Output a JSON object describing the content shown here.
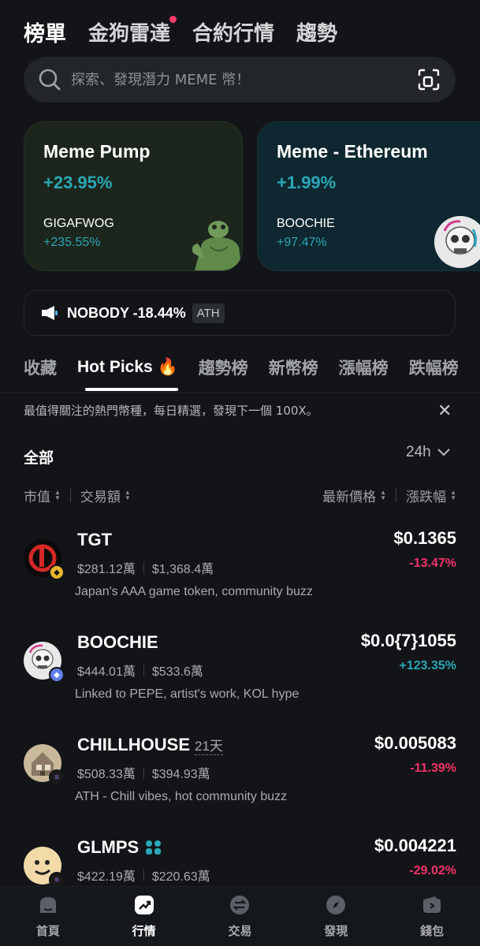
{
  "top_tabs": [
    "榜單",
    "金狗雷達",
    "合約行情",
    "趨勢"
  ],
  "search": {
    "placeholder": "探索、發現潛力 MEME 幣！"
  },
  "cards": [
    {
      "title": "Meme Pump",
      "change": "+23.95%",
      "token": "GIGAFWOG",
      "token_change": "+235.55%"
    },
    {
      "title": "Meme - Ethereum",
      "change": "+1.99%",
      "token": "BOOCHIE",
      "token_change": "+97.47%"
    }
  ],
  "ticker": {
    "text": "NOBODY -18.44%",
    "badge": "ATH"
  },
  "category_tabs": [
    "收藏",
    "Hot Picks 🔥",
    "趨勢榜",
    "新幣榜",
    "漲幅榜",
    "跌幅榜"
  ],
  "description": "最值得關注的熱門幣種，每日精選，發現下一個 100X。",
  "filter": {
    "all": "全部",
    "range": "24h"
  },
  "sort": {
    "market_cap": "市值",
    "volume": "交易額",
    "price": "最新價格",
    "change": "漲跌幅"
  },
  "tokens": [
    {
      "name": "TGT",
      "age": "",
      "market_cap": "$281.12萬",
      "volume": "$1,368.4萬",
      "desc": "Japan's AAA game token, community buzz",
      "price": "$0.1365",
      "change": "-13.47%",
      "direction": "neg"
    },
    {
      "name": "BOOCHIE",
      "age": "",
      "market_cap": "$444.01萬",
      "volume": "$533.6萬",
      "desc": "Linked to PEPE, artist's work, KOL hype",
      "price": "$0.0{7}1055",
      "change": "+123.35%",
      "direction": "pos"
    },
    {
      "name": "CHILLHOUSE",
      "age": "21天",
      "market_cap": "$508.33萬",
      "volume": "$394.93萬",
      "desc": "ATH - Chill vibes, hot community buzz",
      "price": "$0.005083",
      "change": "-11.39%",
      "direction": "neg"
    },
    {
      "name": "GLMPS",
      "age": "",
      "market_cap": "$422.19萬",
      "volume": "$220.63萬",
      "desc": "",
      "price": "$0.004221",
      "change": "-29.02%",
      "direction": "neg"
    }
  ],
  "bottom_nav": [
    "首頁",
    "行情",
    "交易",
    "發現",
    "錢包"
  ],
  "colors": {
    "background": "#121417",
    "positive": "#2aa7b6",
    "negative": "#f2336a"
  }
}
